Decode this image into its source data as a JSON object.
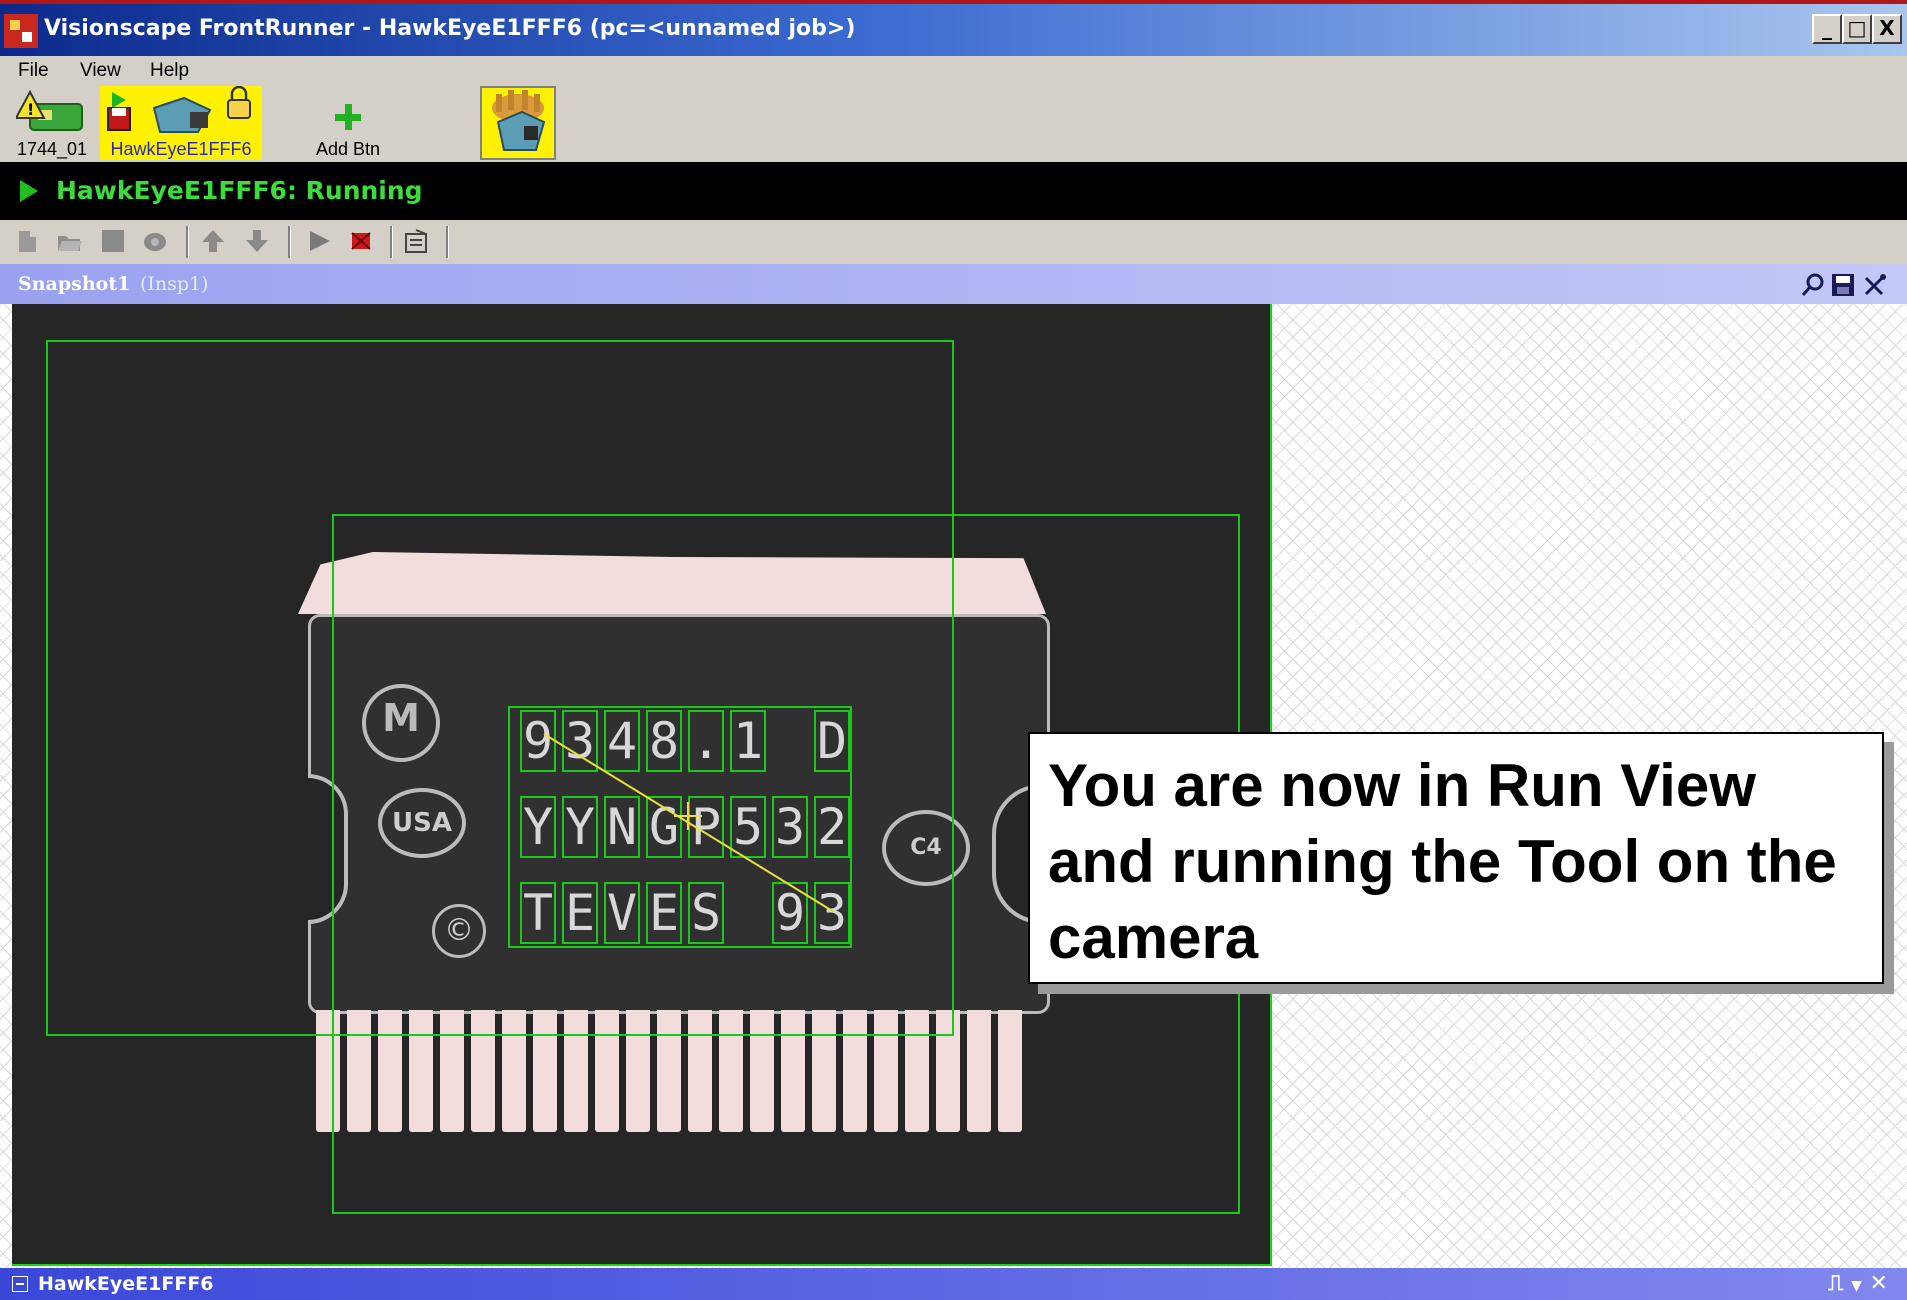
{
  "window": {
    "title": "Visionscape FrontRunner - HawkEyeE1FFF6 (pc=<unnamed job>)",
    "controls": [
      "_",
      "□",
      "X"
    ]
  },
  "menu": {
    "items": [
      "File",
      "View",
      "Help"
    ]
  },
  "devices": {
    "items": [
      {
        "label": "1744_01",
        "icon": "warning-device-icon"
      },
      {
        "label": "HawkEyeE1FFF6",
        "icon": "camera-device-icon",
        "selected": true
      },
      {
        "label": "Add Btn",
        "icon": "add-icon"
      }
    ],
    "highlight_color": "#fff200"
  },
  "status": {
    "text": "HawkEyeE1FFF6: Running",
    "color": "#3ddc3d"
  },
  "snapshot": {
    "title": "Snapshot1",
    "subtitle": "(Insp1)"
  },
  "chip": {
    "ocr_lines": [
      [
        "9",
        "3",
        "4",
        "8",
        ".",
        "1",
        " ",
        "D"
      ],
      [
        "Y",
        "Y",
        "N",
        "G",
        "P",
        "5",
        "3",
        "2"
      ],
      [
        "T",
        "E",
        "V",
        "E",
        "S",
        " ",
        "9",
        "3"
      ]
    ],
    "logo_usa": "USA",
    "logo_c4": "C4",
    "logo_copyright": "©"
  },
  "callout": {
    "text": "You are now in Run View and running the Tool on the camera"
  },
  "bottom": {
    "text": "HawkEyeE1FFF6"
  },
  "colors": {
    "roi": "#19c819",
    "titlebar_start": "#0c2a8c",
    "status_bg": "#000000"
  }
}
